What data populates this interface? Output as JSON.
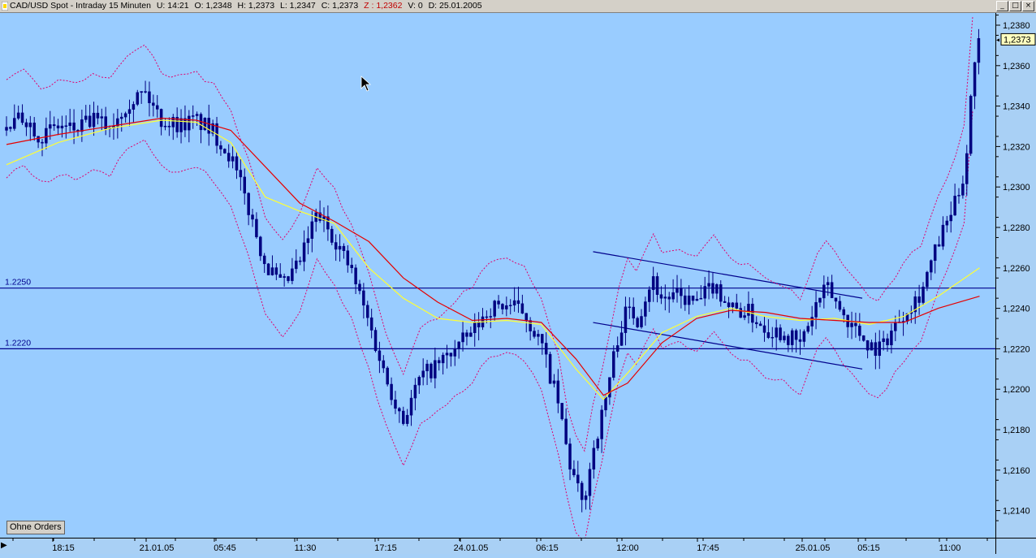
{
  "title_bar": {
    "symbol": "CAD/USD Spot - Intraday 15 Minuten",
    "time": "U: 14:21",
    "open": "O: 1,2348",
    "high": "H: 1,2373",
    "low": "L: 1,2347",
    "close": "C: 1,2373",
    "z": "Z : 1,2362",
    "volume": "V: 0",
    "date": "D: 25.01.2005"
  },
  "window_buttons": [
    "_",
    "□",
    "×"
  ],
  "orders_button": "Ohne Orders",
  "current_price_label": "1,2373",
  "colors": {
    "background": "#99ccff",
    "candles": "#000080",
    "ma_red": "#e60000",
    "ma_yellow": "#ffff33",
    "envelope": "#e0006e",
    "lines": "#00008b"
  },
  "chart_data": {
    "type": "candlestick",
    "timeframe": "15 Minuten",
    "ylim": [
      1.213,
      1.239
    ],
    "y_ticks": [
      "1,2380",
      "1,2360",
      "1,2340",
      "1,2320",
      "1,2300",
      "1,2280",
      "1,2260",
      "1,2240",
      "1,2220",
      "1,2200",
      "1,2180",
      "1,2160",
      "1,2140"
    ],
    "x_ticks": [
      "18:15",
      "21.01.05",
      "05:45",
      "11:30",
      "17:15",
      "24.01.05",
      "06:15",
      "12:00",
      "17:45",
      "25.01.05",
      "05:15",
      "11:00"
    ],
    "horizontal_lines": [
      {
        "label": "1.2250",
        "value": 1.225
      },
      {
        "label": "1.2220",
        "value": 1.222
      }
    ],
    "trend_channel": [
      {
        "name": "upper",
        "start": [
          17.0,
          1.2268
        ],
        "end": [
          24.8,
          1.2245
        ]
      },
      {
        "name": "lower",
        "start": [
          17.0,
          1.2233
        ],
        "end": [
          24.8,
          1.221
        ]
      }
    ],
    "closes": [
      [
        0,
        1.2328
      ],
      [
        0.5,
        1.2335
      ],
      [
        1,
        1.2325
      ],
      [
        1.5,
        1.233
      ],
      [
        2,
        1.2328
      ],
      [
        2.5,
        1.2333
      ],
      [
        3,
        1.233
      ],
      [
        3.5,
        1.2342
      ],
      [
        4,
        1.2347
      ],
      [
        4.5,
        1.2333
      ],
      [
        5,
        1.2331
      ],
      [
        5.5,
        1.2333
      ],
      [
        6,
        1.2327
      ],
      [
        6.5,
        1.2315
      ],
      [
        7,
        1.229
      ],
      [
        7.5,
        1.2262
      ],
      [
        8,
        1.225
      ],
      [
        8.5,
        1.2263
      ],
      [
        9,
        1.2287
      ],
      [
        9.5,
        1.2275
      ],
      [
        10,
        1.2258
      ],
      [
        10.5,
        1.2233
      ],
      [
        11,
        1.2205
      ],
      [
        11.5,
        1.2185
      ],
      [
        12,
        1.2206
      ],
      [
        12.5,
        1.2212
      ],
      [
        13,
        1.222
      ],
      [
        13.5,
        1.2228
      ],
      [
        14,
        1.224
      ],
      [
        14.5,
        1.2242
      ],
      [
        15,
        1.2238
      ],
      [
        15.5,
        1.2222
      ],
      [
        16,
        1.2192
      ],
      [
        16.3,
        1.2164
      ],
      [
        16.7,
        1.2142
      ],
      [
        17,
        1.217
      ],
      [
        17.3,
        1.219
      ],
      [
        17.7,
        1.2225
      ],
      [
        18,
        1.224
      ],
      [
        18.3,
        1.2235
      ],
      [
        18.7,
        1.2255
      ],
      [
        19,
        1.2245
      ],
      [
        19.5,
        1.2246
      ],
      [
        20,
        1.2242
      ],
      [
        20.5,
        1.2252
      ],
      [
        21,
        1.224
      ],
      [
        21.5,
        1.2238
      ],
      [
        22,
        1.223
      ],
      [
        22.5,
        1.2228
      ],
      [
        23,
        1.2222
      ],
      [
        23.5,
        1.2243
      ],
      [
        23.8,
        1.225
      ],
      [
        24.2,
        1.2238
      ],
      [
        24.6,
        1.223
      ],
      [
        25,
        1.2222
      ],
      [
        25.3,
        1.222
      ],
      [
        25.7,
        1.223
      ],
      [
        26,
        1.2238
      ],
      [
        26.5,
        1.2248
      ],
      [
        27,
        1.2272
      ],
      [
        27.5,
        1.2292
      ],
      [
        27.8,
        1.231
      ],
      [
        28,
        1.236
      ],
      [
        28.2,
        1.2373
      ]
    ],
    "ma_red": [
      [
        0,
        1.2321
      ],
      [
        1.5,
        1.2326
      ],
      [
        3,
        1.233
      ],
      [
        4.5,
        1.2334
      ],
      [
        5.5,
        1.2333
      ],
      [
        6.5,
        1.2328
      ],
      [
        7.5,
        1.231
      ],
      [
        8.5,
        1.2292
      ],
      [
        9.5,
        1.2283
      ],
      [
        10.5,
        1.2273
      ],
      [
        11.5,
        1.2255
      ],
      [
        12.5,
        1.2243
      ],
      [
        13.5,
        1.2234
      ],
      [
        14.5,
        1.2235
      ],
      [
        15.5,
        1.2233
      ],
      [
        16.5,
        1.2215
      ],
      [
        17.3,
        1.2197
      ],
      [
        18,
        1.2203
      ],
      [
        19,
        1.2223
      ],
      [
        20,
        1.2235
      ],
      [
        21,
        1.2239
      ],
      [
        22,
        1.2238
      ],
      [
        23,
        1.2235
      ],
      [
        24,
        1.2234
      ],
      [
        25,
        1.2233
      ],
      [
        26,
        1.2233
      ],
      [
        27,
        1.224
      ],
      [
        28.2,
        1.2246
      ]
    ],
    "ma_yellow": [
      [
        0,
        1.2311
      ],
      [
        1.5,
        1.2322
      ],
      [
        3,
        1.2329
      ],
      [
        4.5,
        1.2333
      ],
      [
        5.5,
        1.2332
      ],
      [
        6.5,
        1.2322
      ],
      [
        7.5,
        1.2295
      ],
      [
        8.5,
        1.2288
      ],
      [
        9.5,
        1.2282
      ],
      [
        10.5,
        1.226
      ],
      [
        11.5,
        1.2245
      ],
      [
        12.5,
        1.2235
      ],
      [
        13.5,
        1.2233
      ],
      [
        14.5,
        1.2234
      ],
      [
        15.5,
        1.2232
      ],
      [
        16.5,
        1.221
      ],
      [
        17.3,
        1.2195
      ],
      [
        18,
        1.2208
      ],
      [
        19,
        1.2228
      ],
      [
        20,
        1.2236
      ],
      [
        21,
        1.224
      ],
      [
        22,
        1.2236
      ],
      [
        23,
        1.2234
      ],
      [
        24,
        1.2235
      ],
      [
        25,
        1.2232
      ],
      [
        26,
        1.2236
      ],
      [
        27,
        1.2246
      ],
      [
        28.2,
        1.226
      ]
    ]
  }
}
